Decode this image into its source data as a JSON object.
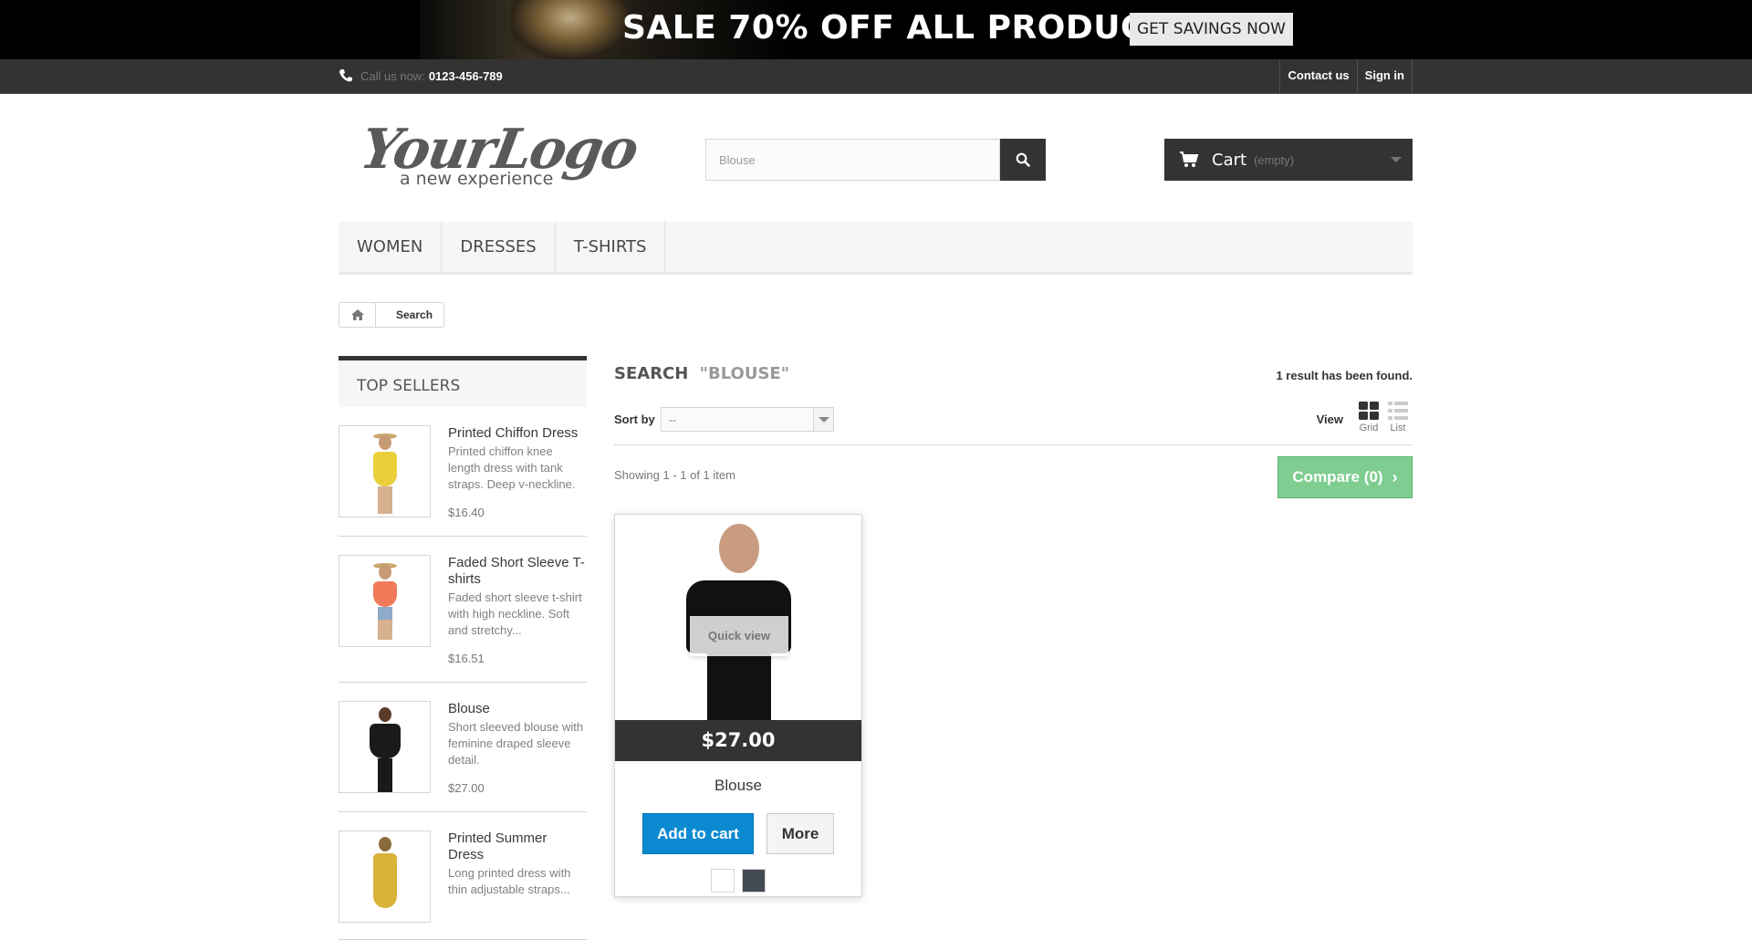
{
  "banner": {
    "text": "SALE 70% OFF ALL PRODUCTS",
    "button": "GET SAVINGS NOW"
  },
  "topnav": {
    "call_label": "Call us now:",
    "phone": "0123-456-789",
    "links": [
      "Contact us",
      "Sign in"
    ]
  },
  "header": {
    "logo_script": "YourLogo",
    "logo_tagline": "a new experience",
    "search": {
      "value": "Blouse"
    },
    "cart": {
      "label": "Cart",
      "status": "(empty)"
    }
  },
  "menu": [
    "WOMEN",
    "DRESSES",
    "T-SHIRTS"
  ],
  "breadcrumb": {
    "current": "Search"
  },
  "sidebar": {
    "title": "TOP SELLERS",
    "items": [
      {
        "name": "Printed Chiffon Dress",
        "desc": "Printed chiffon knee length dress with tank straps. Deep v-neckline.",
        "price": "$16.40",
        "color": "#e9cf3a"
      },
      {
        "name": "Faded Short Sleeve T-shirts",
        "desc": "Faded short sleeve t-shirt with high neckline. Soft and stretchy...",
        "price": "$16.51",
        "color": "#f07a5a"
      },
      {
        "name": "Blouse",
        "desc": "Short sleeved blouse with feminine draped sleeve detail.",
        "price": "$27.00",
        "color": "#1a1a1a"
      },
      {
        "name": "Printed Summer Dress",
        "desc": "Long printed dress with thin adjustable straps...",
        "price": "",
        "color": "#d9b23a"
      }
    ]
  },
  "main": {
    "heading": "Search",
    "query": "\"BLOUSE\"",
    "result_count": "1 result has been found.",
    "sort_label": "Sort by",
    "sort_value": "--",
    "view_label": "View",
    "view_grid": "Grid",
    "view_list": "List",
    "showing": "Showing 1 - 1 of 1 item",
    "compare": "Compare (0)"
  },
  "product": {
    "quick_view": "Quick view",
    "price": "$27.00",
    "name": "Blouse",
    "add_to_cart": "Add to cart",
    "more": "More",
    "swatches": [
      "#ffffff",
      "#434a54"
    ]
  }
}
